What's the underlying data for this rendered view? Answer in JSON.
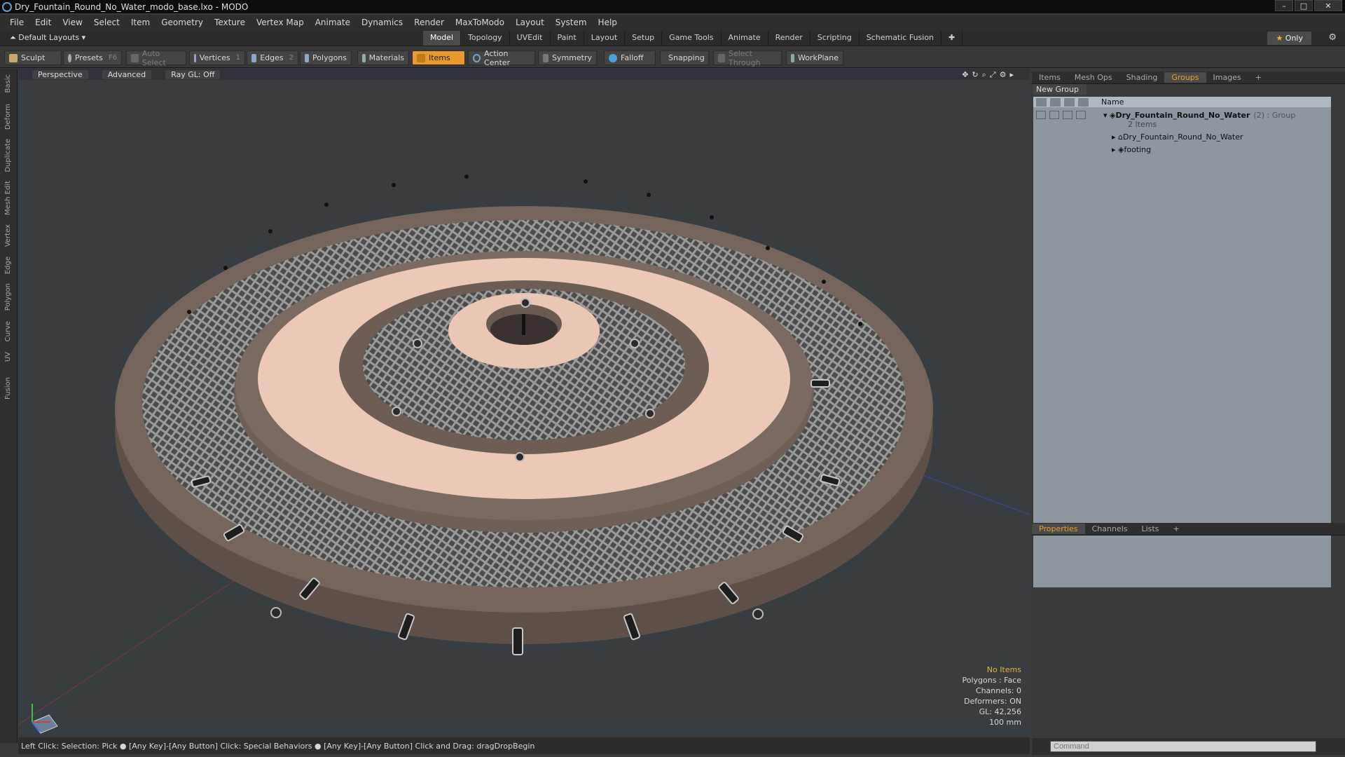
{
  "window": {
    "title": "Dry_Fountain_Round_No_Water_modo_base.lxo - MODO"
  },
  "menu": [
    "File",
    "Edit",
    "View",
    "Select",
    "Item",
    "Geometry",
    "Texture",
    "Vertex Map",
    "Animate",
    "Dynamics",
    "Render",
    "MaxToModo",
    "Layout",
    "System",
    "Help"
  ],
  "layouts_label": "Default Layouts",
  "mode_tabs": [
    "Model",
    "Topology",
    "UVEdit",
    "Paint",
    "Layout",
    "Setup",
    "Game Tools",
    "Animate",
    "Render",
    "Scripting",
    "Schematic Fusion"
  ],
  "only_label": "Only",
  "toolbar": {
    "sculpt": "Sculpt",
    "presets": "Presets",
    "presets_key": "F6",
    "auto_select": "Auto Select",
    "vertices": "Vertices",
    "vertices_count": "1",
    "edges": "Edges",
    "edges_count": "2",
    "polygons": "Polygons",
    "materials": "Materials",
    "items": "Items",
    "action_center": "Action Center",
    "symmetry": "Symmetry",
    "falloff": "Falloff",
    "snapping": "Snapping",
    "select_through": "Select Through",
    "workplane": "WorkPlane"
  },
  "left_tabs": [
    "Basic",
    "Deform",
    "Duplicate",
    "Mesh Edit",
    "Vertex",
    "Edge",
    "Polygon",
    "Curve",
    "UV",
    "Fusion"
  ],
  "viewport": {
    "view": "Perspective",
    "shading": "Advanced",
    "raygl": "Ray GL: Off",
    "info": {
      "no_items": "No Items",
      "polygons": "Polygons : Face",
      "channels": "Channels: 0",
      "deformers": "Deformers: ON",
      "gl": "GL: 42,256",
      "scale": "100 mm"
    }
  },
  "status": "Left Click: Selection: Pick ● [Any Key]-[Any Button] Click: Special Behaviors ● [Any Key]-[Any Button] Click and Drag: dragDropBegin",
  "right_tabs": [
    "Items",
    "Mesh Ops",
    "Shading",
    "Groups",
    "Images"
  ],
  "right_active": "Groups",
  "groups": {
    "new_group": "New Group",
    "header_name": "Name",
    "group_name": "Dry_Fountain_Round_No_Water",
    "group_suffix": "(2) : Group",
    "group_count": "2 Items",
    "children": [
      "Dry_Fountain_Round_No_Water",
      "footing"
    ]
  },
  "lower_tabs": [
    "Properties",
    "Channels",
    "Lists"
  ],
  "lower_active": "Properties",
  "command_placeholder": "Command"
}
